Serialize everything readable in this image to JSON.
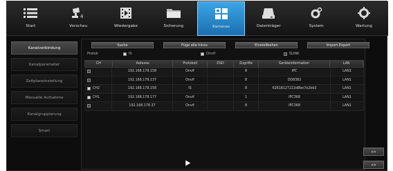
{
  "topbar": {
    "items": [
      {
        "label": "Start",
        "icon": "menu-list-icon"
      },
      {
        "label": "Vorschau",
        "icon": "camera-preview-icon"
      },
      {
        "label": "Wiedergabe",
        "icon": "film-playback-icon"
      },
      {
        "label": "Sicherung",
        "icon": "folder-backup-icon"
      },
      {
        "label": "Kameras",
        "icon": "camera-grid-icon",
        "active": true
      },
      {
        "label": "Datenträger",
        "icon": "hdd-icon"
      },
      {
        "label": "System",
        "icon": "gear-system-icon"
      },
      {
        "label": "Wartung",
        "icon": "gear-maintenance-icon"
      }
    ]
  },
  "sidebar": {
    "items": [
      {
        "label": "Kanalverbindung",
        "active": true
      },
      {
        "label": "Kanalparameter"
      },
      {
        "label": "Zeitplaneinstellung"
      },
      {
        "label": "Manuelle Aufnahme"
      },
      {
        "label": "Kanalgruppierung"
      },
      {
        "label": "Smart"
      }
    ]
  },
  "buttons": {
    "search": "Suche",
    "add_all": "Füge alle hinzu",
    "settings": "Einstellbohen",
    "import_export": "Import Export"
  },
  "protocol": {
    "label": "Protok",
    "options": [
      {
        "label": "IS",
        "checked": true
      },
      {
        "label": "Onvif",
        "checked": true
      },
      {
        "label": "SLINK",
        "checked": false
      }
    ]
  },
  "table": {
    "headers": [
      "CH",
      "Adresse",
      "Protokoll",
      "DSD",
      "Zugriffe",
      "Geräteinformation",
      "LAN"
    ],
    "rows": [
      {
        "checked": false,
        "ch": "",
        "address": "192.168.178.158",
        "protocol": "Onvif",
        "dsd": "",
        "access": "8",
        "device": "IPC",
        "lan": "LAN1"
      },
      {
        "checked": false,
        "ch": "",
        "address": "192.168.178.137",
        "protocol": "Onvif",
        "dsd": "",
        "access": "8",
        "device": "DD8382",
        "lan": "LAN1"
      },
      {
        "checked": true,
        "ch": "CH2",
        "address": "192.168.178.158",
        "protocol": "IS",
        "dsd": "",
        "access": "8",
        "device": "62618127222d8be7e2bb3",
        "lan": "LAN1"
      },
      {
        "checked": true,
        "ch": "CH1",
        "address": "192.168.178.177",
        "protocol": "Onvif",
        "dsd": "",
        "access": "1",
        "device": "IPC368",
        "lan": "LAN1"
      },
      {
        "checked": false,
        "ch": "",
        "address": "192.168.178.37",
        "protocol": "Onvif",
        "dsd": "",
        "access": "8",
        "device": "IPC368",
        "lan": "LAN1"
      }
    ]
  },
  "nav": {
    "next": "»»",
    "prev": "««"
  },
  "colors": {
    "accent": "#2a8fd4",
    "background": "#0d0d0d"
  }
}
